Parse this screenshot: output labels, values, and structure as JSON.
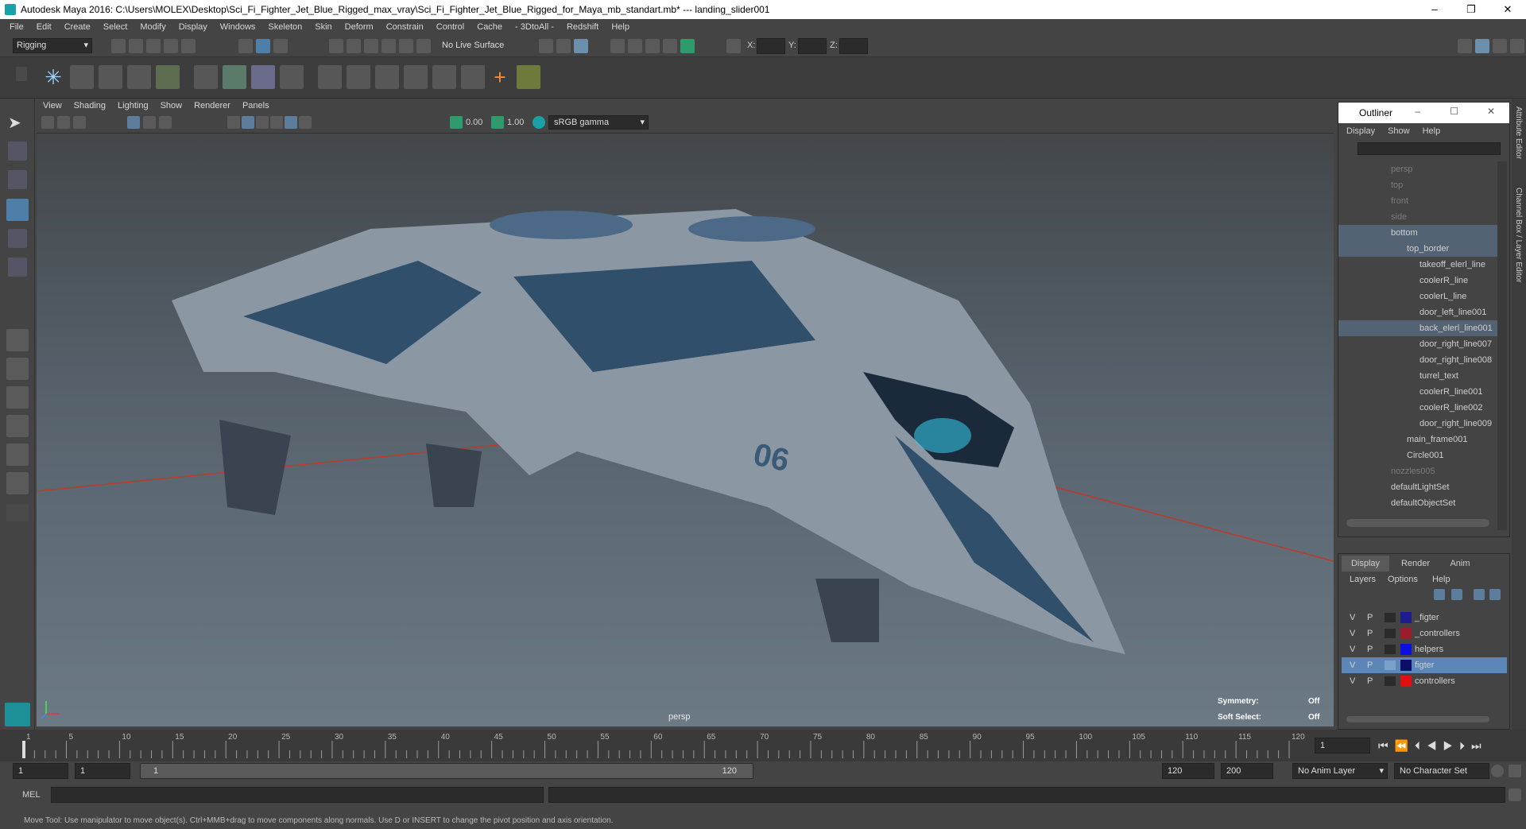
{
  "title": "Autodesk Maya 2016: C:\\Users\\MOLEX\\Desktop\\Sci_Fi_Fighter_Jet_Blue_Rigged_max_vray\\Sci_Fi_Fighter_Jet_Blue_Rigged_for_Maya_mb_standart.mb*  ---  landing_slider001",
  "menu": [
    "File",
    "Edit",
    "Create",
    "Select",
    "Modify",
    "Display",
    "Windows",
    "Skeleton",
    "Skin",
    "Deform",
    "Constrain",
    "Control",
    "Cache",
    "- 3DtoAll -",
    "Redshift",
    "Help"
  ],
  "mode": "Rigging",
  "live_surface": "No Live Surface",
  "coord_labels": [
    "X:",
    "Y:",
    "Z:"
  ],
  "vp_menu": [
    "View",
    "Shading",
    "Lighting",
    "Show",
    "Renderer",
    "Panels"
  ],
  "vp_values": {
    "a": "0.00",
    "b": "1.00",
    "gamma": "sRGB gamma"
  },
  "camera": "persp",
  "hud": {
    "sym_label": "Symmetry:",
    "sym_val": "Off",
    "soft_label": "Soft Select:",
    "soft_val": "Off"
  },
  "outliner": {
    "title": "Outliner",
    "menu": [
      "Display",
      "Show",
      "Help"
    ],
    "items": [
      {
        "label": "persp",
        "dim": true
      },
      {
        "label": "top",
        "dim": true
      },
      {
        "label": "front",
        "dim": true
      },
      {
        "label": "side",
        "dim": true
      },
      {
        "label": "bottom"
      },
      {
        "label": "top_border"
      },
      {
        "label": "takeoff_elerl_line"
      },
      {
        "label": "coolerR_line"
      },
      {
        "label": "coolerL_line"
      },
      {
        "label": "door_left_line001"
      },
      {
        "label": "back_elerl_line001"
      },
      {
        "label": "door_right_line007"
      },
      {
        "label": "door_right_line008"
      },
      {
        "label": "turrel_text"
      },
      {
        "label": "coolerR_line001"
      },
      {
        "label": "coolerR_line002"
      },
      {
        "label": "door_right_line009"
      },
      {
        "label": "main_frame001"
      },
      {
        "label": "Circle001"
      },
      {
        "label": "nozzles005",
        "dim": true
      },
      {
        "label": "defaultLightSet"
      },
      {
        "label": "defaultObjectSet"
      }
    ]
  },
  "layer_tabs": [
    "Display",
    "Render",
    "Anim"
  ],
  "layer_menu": [
    "Layers",
    "Options",
    "Help"
  ],
  "layers": [
    {
      "v": "V",
      "p": "P",
      "name": "_figter",
      "color": "#1c1c8c"
    },
    {
      "v": "V",
      "p": "P",
      "name": "_controllers",
      "color": "#9c1c2c"
    },
    {
      "v": "V",
      "p": "P",
      "name": "helpers",
      "color": "#0a10e0"
    },
    {
      "v": "V",
      "p": "P",
      "name": "figter",
      "color": "#0d0d6a"
    },
    {
      "v": "V",
      "p": "P",
      "name": "controllers",
      "color": "#e01010"
    }
  ],
  "timeline": {
    "ticks": [
      "1",
      "5",
      "10",
      "15",
      "20",
      "25",
      "30",
      "35",
      "40",
      "45",
      "50",
      "55",
      "60",
      "65",
      "70",
      "75",
      "80",
      "85",
      "90",
      "95",
      "100",
      "105",
      "110",
      "115",
      "120"
    ],
    "current": "1"
  },
  "range": {
    "start": "1",
    "start2": "1",
    "slider_start": "1",
    "slider_end": "120",
    "end": "120",
    "end2": "200",
    "anim_layer": "No Anim Layer",
    "char_set": "No Character Set"
  },
  "cmd_label": "MEL",
  "help": "Move Tool: Use manipulator to move object(s). Ctrl+MMB+drag to move components along normals. Use D or INSERT to change the pivot position and axis orientation.",
  "side_tabs": [
    "Attribute Editor",
    "Channel Box / Layer Editor"
  ]
}
